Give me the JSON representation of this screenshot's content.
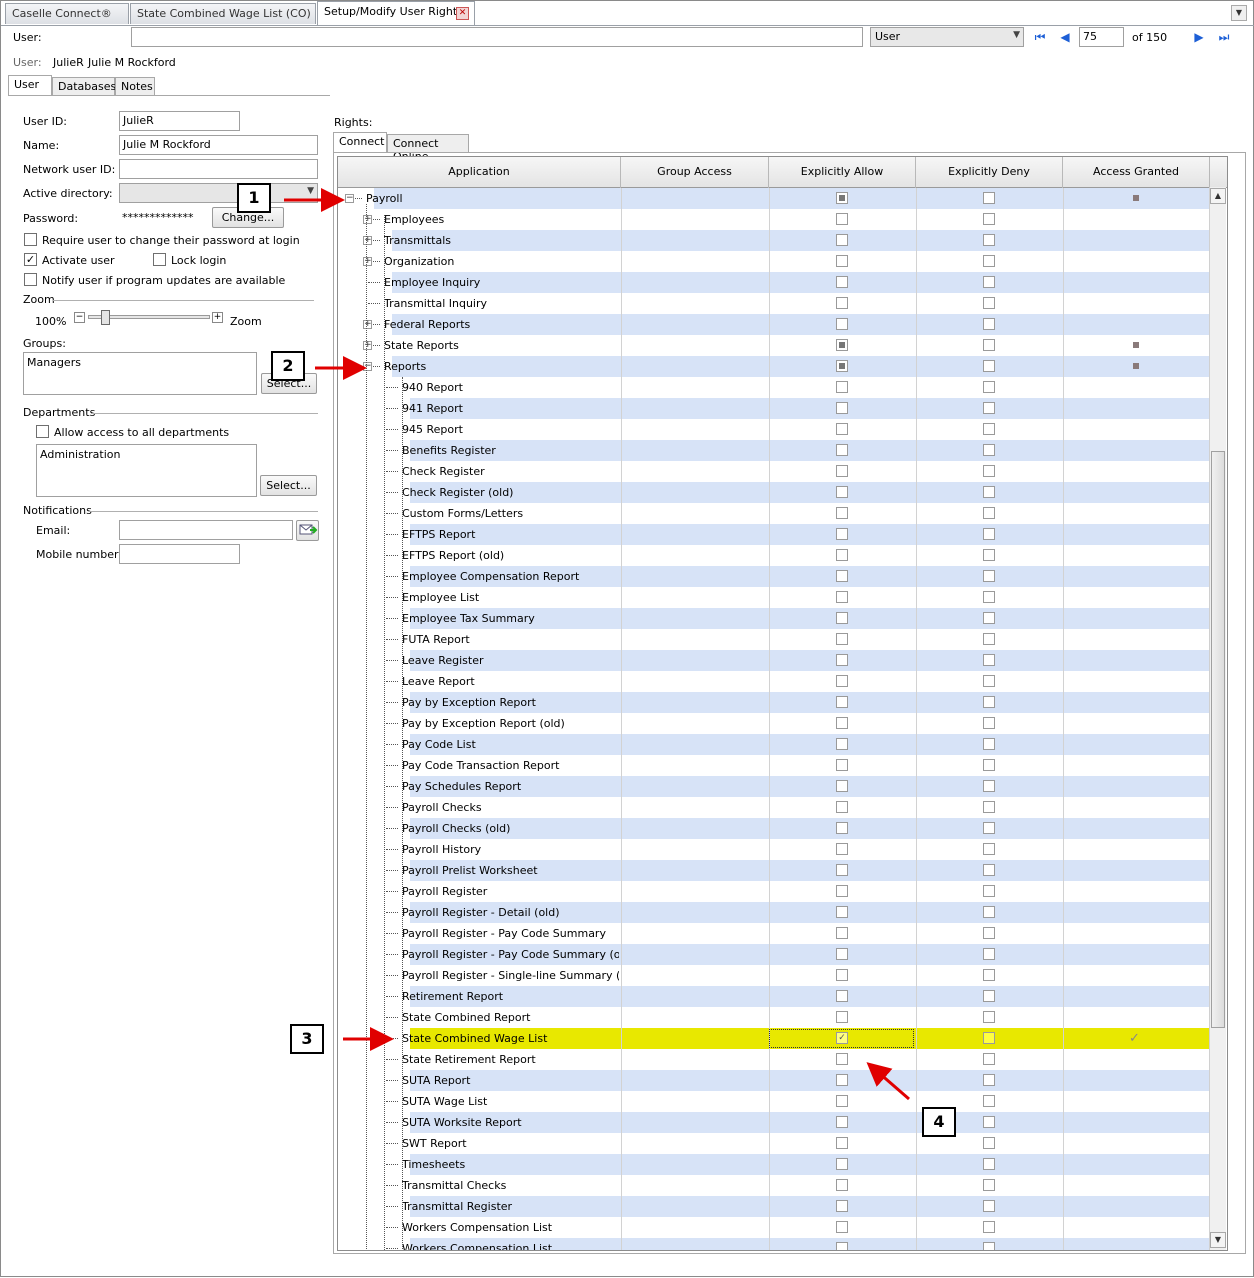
{
  "doc_tabs": [
    "Caselle Connect®",
    "State Combined Wage List (CO)",
    "Setup/Modify User Rights"
  ],
  "toolbar": {
    "user_label": "User:",
    "user_value": "",
    "type_select": "User",
    "record_number": "75",
    "of_total": "of 150"
  },
  "user_summary": {
    "label": "User:",
    "id": "JulieR",
    "name": "Julie M Rockford"
  },
  "left_tabs": [
    "User",
    "Databases",
    "Notes"
  ],
  "form": {
    "user_id_label": "User ID:",
    "user_id": "JulieR",
    "name_label": "Name:",
    "name": "Julie M Rockford",
    "network_label": "Network user ID:",
    "network": "",
    "ad_label": "Active directory:",
    "password_label": "Password:",
    "password_mask": "*************",
    "change_button": "Change...",
    "require_change": "Require user to change their password at login",
    "activate_user": "Activate user",
    "lock_login": "Lock login",
    "notify_updates": "Notify user if program updates are available",
    "zoom_section": "Zoom",
    "zoom_value": "100%",
    "zoom_label": "Zoom",
    "groups_label": "Groups:",
    "groups_value": "Managers",
    "groups_select": "Select...",
    "departments_section": "Departments",
    "allow_all_depts": "Allow access to all departments",
    "departments_value": "Administration",
    "depts_select": "Select...",
    "notifications_section": "Notifications",
    "email_label": "Email:",
    "email": "",
    "mobile_label": "Mobile number:",
    "mobile": ""
  },
  "rights": {
    "label": "Rights:",
    "tabs": [
      "Connect",
      "Connect Online"
    ],
    "columns": [
      "Application",
      "Group Access",
      "Explicitly Allow",
      "Explicitly Deny",
      "Access Granted"
    ],
    "rows": [
      {
        "label": "Payroll",
        "level": 0,
        "exp": "minus",
        "allow": "partial",
        "granted": "partial"
      },
      {
        "label": "Employees",
        "level": 1,
        "exp": "plus",
        "allow": "none",
        "granted": "none"
      },
      {
        "label": "Transmittals",
        "level": 1,
        "exp": "plus",
        "allow": "none",
        "granted": "none"
      },
      {
        "label": "Organization",
        "level": 1,
        "exp": "plus",
        "allow": "none",
        "granted": "none"
      },
      {
        "label": "Employee Inquiry",
        "level": 1,
        "exp": "leaf",
        "allow": "none",
        "granted": "none"
      },
      {
        "label": "Transmittal Inquiry",
        "level": 1,
        "exp": "leaf",
        "allow": "none",
        "granted": "none"
      },
      {
        "label": "Federal Reports",
        "level": 1,
        "exp": "plus",
        "allow": "none",
        "granted": "none"
      },
      {
        "label": "State Reports",
        "level": 1,
        "exp": "plus",
        "allow": "partial",
        "granted": "partial"
      },
      {
        "label": "Reports",
        "level": 1,
        "exp": "minus",
        "allow": "partial",
        "granted": "partial"
      },
      {
        "label": "940 Report",
        "level": 2,
        "exp": "leaf",
        "allow": "none",
        "granted": "none"
      },
      {
        "label": "941 Report",
        "level": 2,
        "exp": "leaf",
        "allow": "none",
        "granted": "none"
      },
      {
        "label": "945 Report",
        "level": 2,
        "exp": "leaf",
        "allow": "none",
        "granted": "none"
      },
      {
        "label": "Benefits Register",
        "level": 2,
        "exp": "leaf",
        "allow": "none",
        "granted": "none"
      },
      {
        "label": "Check Register",
        "level": 2,
        "exp": "leaf",
        "allow": "none",
        "granted": "none"
      },
      {
        "label": "Check Register (old)",
        "level": 2,
        "exp": "leaf",
        "allow": "none",
        "granted": "none"
      },
      {
        "label": "Custom Forms/Letters",
        "level": 2,
        "exp": "leaf",
        "allow": "none",
        "granted": "none"
      },
      {
        "label": "EFTPS Report",
        "level": 2,
        "exp": "leaf",
        "allow": "none",
        "granted": "none"
      },
      {
        "label": "EFTPS Report (old)",
        "level": 2,
        "exp": "leaf",
        "allow": "none",
        "granted": "none"
      },
      {
        "label": "Employee Compensation Report",
        "level": 2,
        "exp": "leaf",
        "allow": "none",
        "granted": "none"
      },
      {
        "label": "Employee List",
        "level": 2,
        "exp": "leaf",
        "allow": "none",
        "granted": "none"
      },
      {
        "label": "Employee Tax Summary",
        "level": 2,
        "exp": "leaf",
        "allow": "none",
        "granted": "none"
      },
      {
        "label": "FUTA Report",
        "level": 2,
        "exp": "leaf",
        "allow": "none",
        "granted": "none"
      },
      {
        "label": "Leave Register",
        "level": 2,
        "exp": "leaf",
        "allow": "none",
        "granted": "none"
      },
      {
        "label": "Leave Report",
        "level": 2,
        "exp": "leaf",
        "allow": "none",
        "granted": "none"
      },
      {
        "label": "Pay by Exception Report",
        "level": 2,
        "exp": "leaf",
        "allow": "none",
        "granted": "none"
      },
      {
        "label": "Pay by Exception Report (old)",
        "level": 2,
        "exp": "leaf",
        "allow": "none",
        "granted": "none"
      },
      {
        "label": "Pay Code List",
        "level": 2,
        "exp": "leaf",
        "allow": "none",
        "granted": "none"
      },
      {
        "label": "Pay Code Transaction Report",
        "level": 2,
        "exp": "leaf",
        "allow": "none",
        "granted": "none"
      },
      {
        "label": "Pay Schedules Report",
        "level": 2,
        "exp": "leaf",
        "allow": "none",
        "granted": "none"
      },
      {
        "label": "Payroll Checks",
        "level": 2,
        "exp": "leaf",
        "allow": "none",
        "granted": "none"
      },
      {
        "label": "Payroll Checks (old)",
        "level": 2,
        "exp": "leaf",
        "allow": "none",
        "granted": "none"
      },
      {
        "label": "Payroll History",
        "level": 2,
        "exp": "leaf",
        "allow": "none",
        "granted": "none"
      },
      {
        "label": "Payroll Prelist Worksheet",
        "level": 2,
        "exp": "leaf",
        "allow": "none",
        "granted": "none"
      },
      {
        "label": "Payroll Register",
        "level": 2,
        "exp": "leaf",
        "allow": "none",
        "granted": "none"
      },
      {
        "label": "Payroll Register - Detail (old)",
        "level": 2,
        "exp": "leaf",
        "allow": "none",
        "granted": "none"
      },
      {
        "label": "Payroll Register - Pay Code Summary",
        "level": 2,
        "exp": "leaf",
        "allow": "none",
        "granted": "none"
      },
      {
        "label": "Payroll Register - Pay Code Summary (o...",
        "level": 2,
        "exp": "leaf",
        "allow": "none",
        "granted": "none"
      },
      {
        "label": "Payroll Register - Single-line Summary (...",
        "level": 2,
        "exp": "leaf",
        "allow": "none",
        "granted": "none"
      },
      {
        "label": "Retirement Report",
        "level": 2,
        "exp": "leaf",
        "allow": "none",
        "granted": "none"
      },
      {
        "label": "State Combined Report",
        "level": 2,
        "exp": "leaf",
        "allow": "none",
        "granted": "none"
      },
      {
        "label": "State Combined Wage List",
        "level": 2,
        "exp": "leaf",
        "allow": "checked",
        "granted": "checked",
        "selected": true
      },
      {
        "label": "State Retirement Report",
        "level": 2,
        "exp": "leaf",
        "allow": "none",
        "granted": "none"
      },
      {
        "label": "SUTA Report",
        "level": 2,
        "exp": "leaf",
        "allow": "none",
        "granted": "none"
      },
      {
        "label": "SUTA Wage List",
        "level": 2,
        "exp": "leaf",
        "allow": "none",
        "granted": "none"
      },
      {
        "label": "SUTA Worksite Report",
        "level": 2,
        "exp": "leaf",
        "allow": "none",
        "granted": "none"
      },
      {
        "label": "SWT Report",
        "level": 2,
        "exp": "leaf",
        "allow": "none",
        "granted": "none"
      },
      {
        "label": "Timesheets",
        "level": 2,
        "exp": "leaf",
        "allow": "none",
        "granted": "none"
      },
      {
        "label": "Transmittal Checks",
        "level": 2,
        "exp": "leaf",
        "allow": "none",
        "granted": "none"
      },
      {
        "label": "Transmittal Register",
        "level": 2,
        "exp": "leaf",
        "allow": "none",
        "granted": "none"
      },
      {
        "label": "Workers Compensation List",
        "level": 2,
        "exp": "leaf",
        "allow": "none",
        "granted": "none"
      },
      {
        "label": "Workers Compensation List",
        "level": 2,
        "exp": "leaf",
        "allow": "none",
        "granted": "none"
      }
    ]
  },
  "callouts": [
    "1",
    "2",
    "3",
    "4"
  ],
  "colors": {
    "row_alt": "#d7e3f7",
    "row_selected": "#e8e800",
    "arrow": "#e00000",
    "nav_blue": "#1d5fd6"
  }
}
